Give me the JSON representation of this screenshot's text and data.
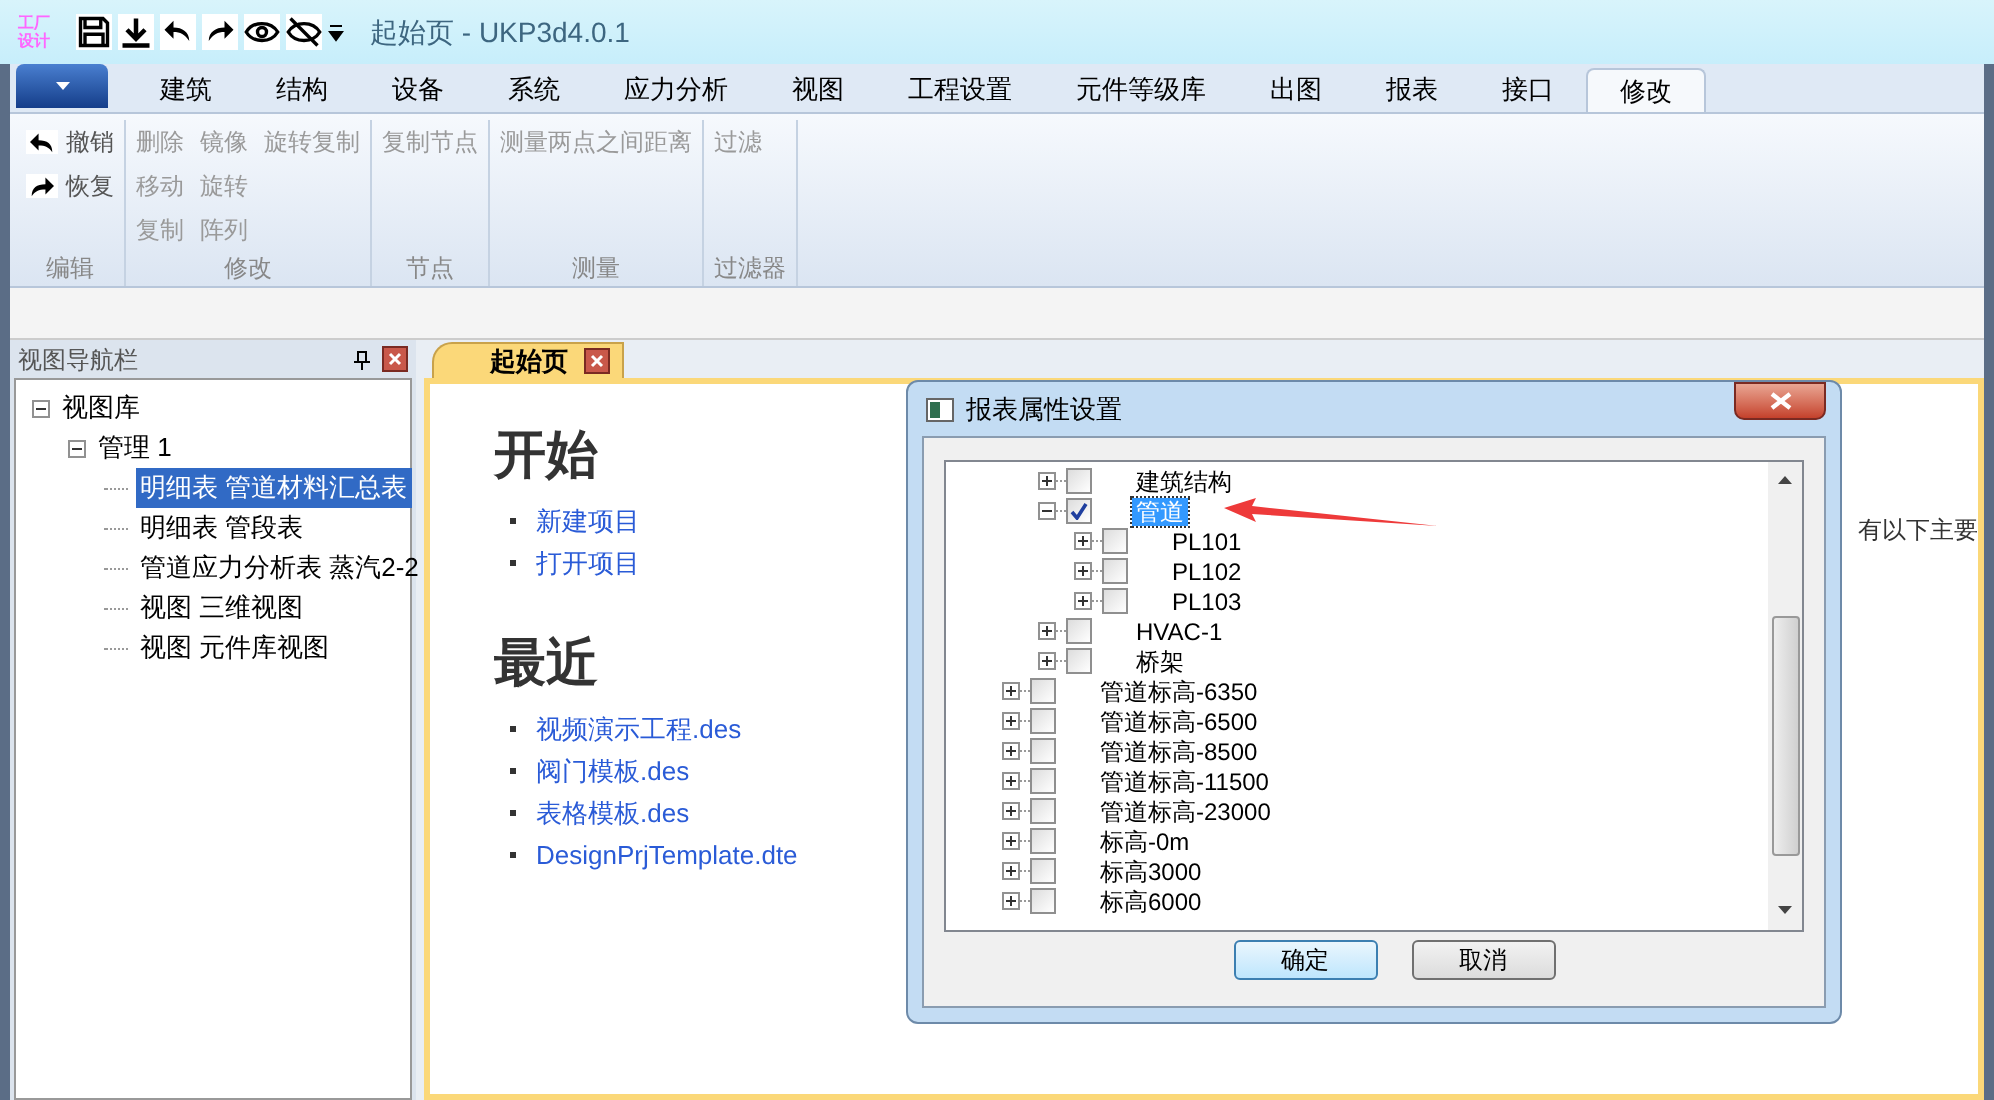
{
  "title_bar": {
    "logo": "工厂设计",
    "title": "起始页 - UKP3d4.0.1"
  },
  "ribbon": {
    "tabs": [
      {
        "label": "建筑",
        "selected": false
      },
      {
        "label": "结构",
        "selected": false
      },
      {
        "label": "设备",
        "selected": false
      },
      {
        "label": "系统",
        "selected": false
      },
      {
        "label": "应力分析",
        "selected": false
      },
      {
        "label": "视图",
        "selected": false
      },
      {
        "label": "工程设置",
        "selected": false
      },
      {
        "label": "元件等级库",
        "selected": false
      },
      {
        "label": "出图",
        "selected": false
      },
      {
        "label": "报表",
        "selected": false
      },
      {
        "label": "接口",
        "selected": false
      },
      {
        "label": "修改",
        "selected": true
      }
    ],
    "groups": [
      {
        "label": "编辑",
        "columns": [
          [
            {
              "label": "撤销",
              "kind": "undo",
              "disabled": false
            },
            {
              "label": "恢复",
              "kind": "redo",
              "disabled": false
            }
          ]
        ]
      },
      {
        "label": "修改",
        "columns": [
          [
            {
              "label": "删除",
              "disabled": true
            },
            {
              "label": "移动",
              "disabled": true
            },
            {
              "label": "复制",
              "disabled": true
            }
          ],
          [
            {
              "label": "镜像",
              "disabled": true
            },
            {
              "label": "旋转",
              "disabled": true
            },
            {
              "label": "阵列",
              "disabled": true
            }
          ],
          [
            {
              "label": "旋转复制",
              "disabled": true
            }
          ]
        ]
      },
      {
        "label": "节点",
        "columns": [
          [
            {
              "label": "复制节点",
              "disabled": true
            }
          ]
        ]
      },
      {
        "label": "测量",
        "columns": [
          [
            {
              "label": "测量两点之间距离",
              "disabled": true
            }
          ]
        ]
      },
      {
        "label": "过滤器",
        "columns": [
          [
            {
              "label": "过滤",
              "disabled": true
            }
          ]
        ]
      }
    ]
  },
  "nav_panel": {
    "title": "视图导航栏",
    "tree": [
      {
        "label": "视图库",
        "expanded": true,
        "selected": false,
        "children": [
          {
            "label": "管理 1",
            "expanded": true,
            "selected": false,
            "children": [
              {
                "label": "明细表 管道材料汇总表",
                "selected": true
              },
              {
                "label": "明细表 管段表",
                "selected": false
              },
              {
                "label": "管道应力分析表 蒸汽2-2",
                "selected": false
              },
              {
                "label": "视图 三维视图",
                "selected": false
              },
              {
                "label": "视图 元件库视图",
                "selected": false
              }
            ]
          }
        ]
      }
    ]
  },
  "document": {
    "tab": {
      "label": "起始页",
      "selected": true
    },
    "start_heading": "开始",
    "start_links": [
      "新建项目",
      "打开项目"
    ],
    "recent_heading": "最近",
    "recent_links": [
      "视频演示工程.des",
      "阀门模板.des",
      "表格模板.des",
      "DesignPrjTemplate.dte"
    ],
    "side_text": "有以下主要"
  },
  "dialog": {
    "title": "报表属性设置",
    "tree": [
      {
        "children": [
          {
            "label": "建筑结构",
            "checked": false,
            "expanded": false,
            "selected": false
          },
          {
            "label": "管道",
            "checked": true,
            "expanded": true,
            "selected": true,
            "children": [
              {
                "label": "PL101",
                "checked": false,
                "expanded": false,
                "selected": false
              },
              {
                "label": "PL102",
                "checked": false,
                "expanded": false,
                "selected": false
              },
              {
                "label": "PL103",
                "checked": false,
                "expanded": false,
                "selected": false
              }
            ]
          },
          {
            "label": "HVAC-1",
            "checked": false,
            "expanded": false,
            "selected": false
          },
          {
            "label": "桥架",
            "checked": false,
            "expanded": false,
            "selected": false
          }
        ]
      },
      {
        "label": "管道标高-6350",
        "checked": false,
        "expanded": false,
        "selected": false
      },
      {
        "label": "管道标高-6500",
        "checked": false,
        "expanded": false,
        "selected": false
      },
      {
        "label": "管道标高-8500",
        "checked": false,
        "expanded": false,
        "selected": false
      },
      {
        "label": "管道标高-11500",
        "checked": false,
        "expanded": false,
        "selected": false
      },
      {
        "label": "管道标高-23000",
        "checked": false,
        "expanded": false,
        "selected": false
      },
      {
        "label": "标高-0m",
        "checked": false,
        "expanded": false,
        "selected": false
      },
      {
        "label": "标高3000",
        "checked": false,
        "expanded": false,
        "selected": false
      },
      {
        "label": "标高6000",
        "checked": false,
        "expanded": false,
        "selected": false
      }
    ],
    "buttons": [
      {
        "label": "确定",
        "kind": "default"
      },
      {
        "label": "取消",
        "kind": "normal"
      }
    ]
  }
}
